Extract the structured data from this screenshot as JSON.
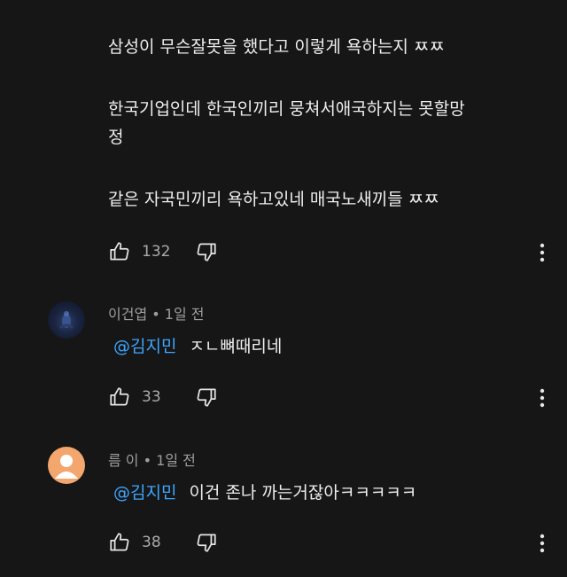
{
  "main_comment": {
    "lines": [
      "삼성이 무슨잘못을 했다고 이렇게 욕하는지 ㅉㅉ",
      "",
      "한국기업인데 한국인끼리 뭉쳐서애국하지는 못할망",
      "정",
      "",
      "같은 자국민끼리 욕하고있네 매국노새끼들 ㅉㅉ"
    ],
    "likes": "132"
  },
  "replies": [
    {
      "author": "이건엽",
      "separator": "•",
      "time": "1일 전",
      "mention": "@김지민",
      "text": "ㅈㄴ뼈때리네",
      "likes": "33",
      "avatar": "dark-figure-avatar"
    },
    {
      "author": "름 이",
      "separator": "•",
      "time": "1일 전",
      "mention": "@김지민",
      "text": "이건 존나 까는거잖아ㅋㅋㅋㅋㅋ",
      "likes": "38",
      "avatar": "default-person-avatar"
    }
  ],
  "icons": {
    "like": "thumbs-up-icon",
    "dislike": "thumbs-down-icon",
    "more": "more-vertical-icon"
  },
  "colors": {
    "background": "#161616",
    "text": "#eeeeee",
    "meta": "#9e9e9e",
    "mention": "#3ea6ff",
    "default_avatar": "#f3a66e"
  }
}
